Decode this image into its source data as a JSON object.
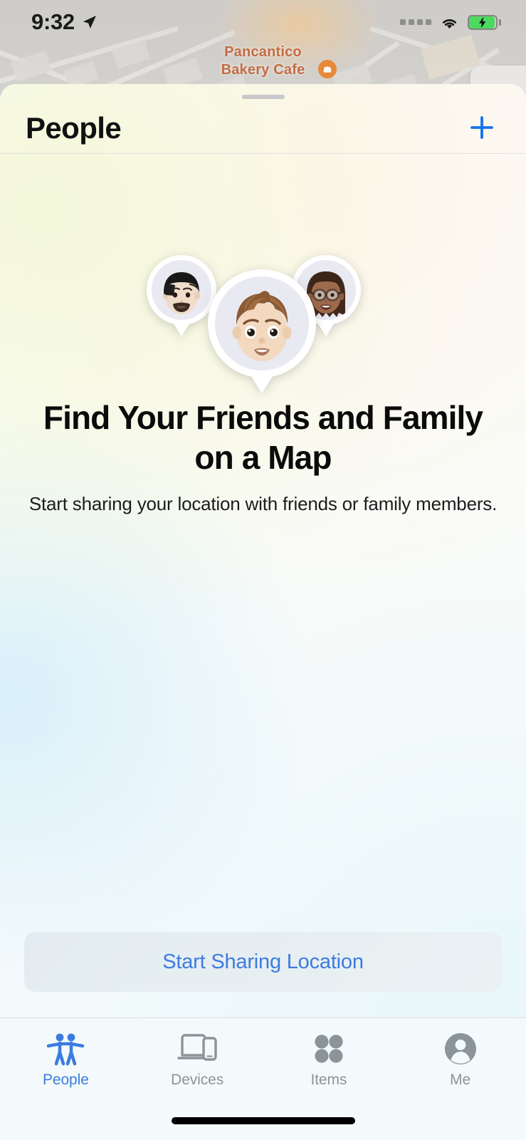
{
  "status_bar": {
    "time": "9:32",
    "location_arrow_icon": "navigation-arrow-icon",
    "signal_icon": "signal-dots-icon",
    "wifi_icon": "wifi-icon",
    "battery_icon": "battery-charging-icon",
    "battery_charging": true
  },
  "map_backdrop": {
    "poi_label_line1": "Pancantico",
    "poi_label_line2": "Bakery Cafe",
    "poi_icon": "bakery-icon",
    "poi_color": "#c2643a"
  },
  "sheet": {
    "grabber_icon": "sheet-grabber-icon",
    "title": "People",
    "add_button_icon": "plus-icon",
    "add_button_label": "+"
  },
  "empty_state": {
    "avatars": [
      {
        "name": "memoji-avatar-left",
        "hair": "black",
        "feature": "mustache"
      },
      {
        "name": "memoji-avatar-center",
        "hair": "brown",
        "feature": "none"
      },
      {
        "name": "memoji-avatar-right",
        "hair": "dark-brown",
        "feature": "glasses"
      }
    ],
    "headline": "Find Your Friends and Family on a Map",
    "subtitle": "Start sharing your location with friends or family members."
  },
  "cta": {
    "label": "Start Sharing Location",
    "text_color": "#3c7be0"
  },
  "tab_bar": {
    "active_color": "#3c7be0",
    "inactive_color": "#8b9499",
    "tabs": [
      {
        "label": "People",
        "icon": "people-icon",
        "active": true
      },
      {
        "label": "Devices",
        "icon": "devices-icon",
        "active": false
      },
      {
        "label": "Items",
        "icon": "items-icon",
        "active": false
      },
      {
        "label": "Me",
        "icon": "person-circle-icon",
        "active": false
      }
    ]
  },
  "home_indicator": "home-indicator"
}
